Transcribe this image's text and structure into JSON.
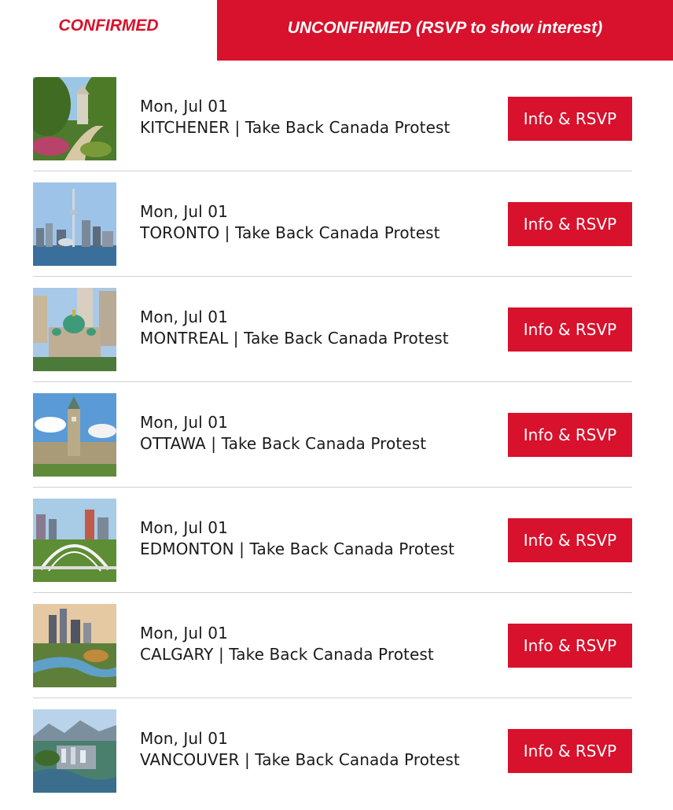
{
  "tabs": {
    "confirmed_label": "CONFIRMED",
    "unconfirmed_label": "UNCONFIRMED (RSVP to show interest)"
  },
  "theme": {
    "accent": "#d8112c",
    "divider": "#cfcfcf"
  },
  "events": [
    {
      "date": "Mon, Jul 01",
      "title": "KITCHENER | Take Back Canada Protest",
      "button": "Info & RSVP",
      "image_icon": "park-monument-photo"
    },
    {
      "date": "Mon, Jul 01",
      "title": "TORONTO | Take Back Canada Protest",
      "button": "Info & RSVP",
      "image_icon": "cn-tower-skyline-photo"
    },
    {
      "date": "Mon, Jul 01",
      "title": "MONTREAL | Take Back Canada Protest",
      "button": "Info & RSVP",
      "image_icon": "cathedral-city-photo"
    },
    {
      "date": "Mon, Jul 01",
      "title": "OTTAWA | Take Back Canada Protest",
      "button": "Info & RSVP",
      "image_icon": "parliament-hill-photo"
    },
    {
      "date": "Mon, Jul 01",
      "title": "EDMONTON | Take Back Canada Protest",
      "button": "Info & RSVP",
      "image_icon": "arch-bridge-skyline-photo"
    },
    {
      "date": "Mon, Jul 01",
      "title": "CALGARY | Take Back Canada Protest",
      "button": "Info & RSVP",
      "image_icon": "river-skyline-photo"
    },
    {
      "date": "Mon, Jul 01",
      "title": "VANCOUVER | Take Back Canada Protest",
      "button": "Info & RSVP",
      "image_icon": "aerial-city-mountains-photo"
    }
  ]
}
